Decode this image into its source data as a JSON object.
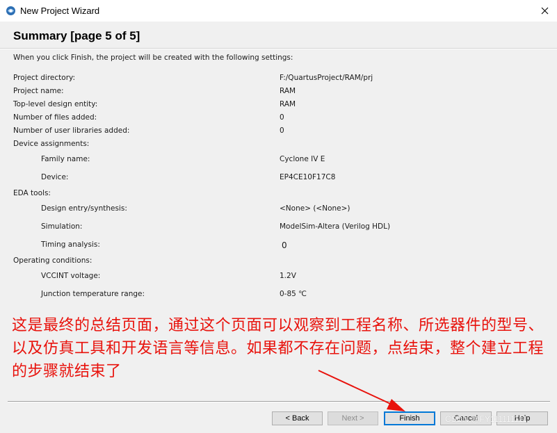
{
  "window": {
    "title": "New Project Wizard",
    "close_glyph": "✕"
  },
  "page": {
    "heading": "Summary [page 5 of 5]",
    "intro": "When you click Finish, the project will be created with the following settings:"
  },
  "settings": {
    "project_directory": {
      "label": "Project directory:",
      "value": "F:/QuartusProject/RAM/prj"
    },
    "project_name": {
      "label": "Project name:",
      "value": "RAM"
    },
    "top_level_entity": {
      "label": "Top-level design entity:",
      "value": "RAM"
    },
    "files_added": {
      "label": "Number of files added:",
      "value": "0"
    },
    "user_libraries_added": {
      "label": "Number of user libraries added:",
      "value": "0"
    },
    "device_assignments": {
      "label": "Device assignments:"
    },
    "family_name": {
      "label": "Family name:",
      "value": "Cyclone IV E"
    },
    "device": {
      "label": "Device:",
      "value": "EP4CE10F17C8"
    },
    "eda_tools": {
      "label": "EDA tools:"
    },
    "design_entry": {
      "label": "Design entry/synthesis:",
      "value": "<None> (<None>)"
    },
    "simulation": {
      "label": "Simulation:",
      "value": "ModelSim-Altera (Verilog HDL)"
    },
    "timing_analysis": {
      "label": "Timing analysis:",
      "value": "0"
    },
    "operating_conditions": {
      "label": "Operating conditions:"
    },
    "vccint_voltage": {
      "label": "VCCINT voltage:",
      "value": "1.2V"
    },
    "junction_temp": {
      "label": "Junction temperature range:",
      "value": "0-85 ℃"
    }
  },
  "annotation": {
    "text": "这是最终的总结页面，通过这个页面可以观察到工程名称、所选器件的型号、以及仿真工具和开发语言等信息。如果都不存在问题，点结束，整个建立工程的步骤就结束了",
    "color": "#e8120c"
  },
  "buttons": {
    "back": "< Back",
    "next": "Next >",
    "finish": "Finish",
    "cancel": "Cancel",
    "help": "Help"
  },
  "watermark": "CSDN @FY111111111",
  "colors": {
    "accent": "#0078d7",
    "annotation_red": "#e8120c"
  }
}
